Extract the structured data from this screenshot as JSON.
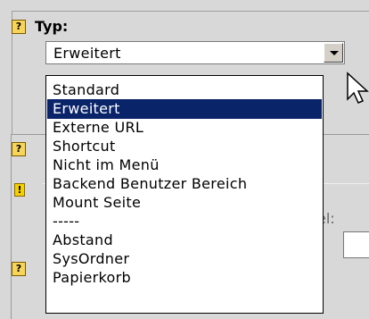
{
  "field": {
    "label": "Typ:",
    "selected_value": "Erweitert"
  },
  "dropdown": {
    "options": [
      "Standard",
      "Erweitert",
      "Externe URL",
      "Shortcut",
      "Nicht im Menü",
      "Backend Benutzer Bereich",
      "Mount Seite",
      "-----",
      "Abstand",
      "SysOrdner",
      "Papierkorb"
    ],
    "selected_index": 1
  },
  "partial": {
    "right_label_fragment": "el:"
  },
  "colors": {
    "selection": "#0a246a",
    "panel": "#d8d8d8",
    "help_icon": "#f7d45a",
    "warning_icon": "#f4d000"
  },
  "icons": {
    "help": "question-mark-help-icon",
    "warning": "exclamation-warning-icon",
    "pointer": "mouse-pointer-icon"
  }
}
